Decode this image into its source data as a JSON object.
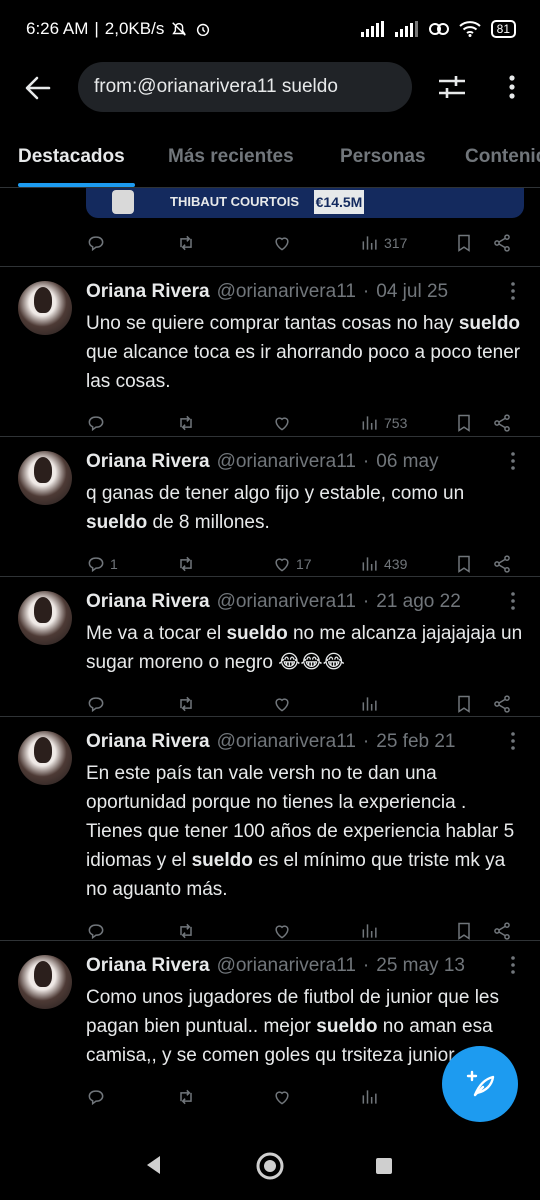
{
  "status": {
    "time": "6:26 AM",
    "speed": "2,0KB/s",
    "battery": "81"
  },
  "search": {
    "query": "from:@orianarivera11 sueldo"
  },
  "tabs": [
    {
      "label": "Destacados"
    },
    {
      "label": "Más recientes"
    },
    {
      "label": "Personas"
    },
    {
      "label": "Contenido"
    }
  ],
  "top_card": {
    "name": "THIBAUT COURTOIS",
    "price": "€14.5M",
    "views": "317"
  },
  "tweets": [
    {
      "name": "Oriana Rivera",
      "handle": "@orianarivera11",
      "date": "04 jul 25",
      "text_parts": [
        "Uno se quiere comprar tantas cosas no hay ",
        "sueldo",
        " que alcance toca es ir ahorrando poco a poco tener las cosas."
      ],
      "replies": "",
      "likes": "",
      "views": "753"
    },
    {
      "name": "Oriana Rivera",
      "handle": "@orianarivera11",
      "date": "06 may",
      "text_parts": [
        "q ganas de tener algo fijo y estable, como un ",
        "sueldo",
        " de 8 millones."
      ],
      "replies": "1",
      "likes": "17",
      "views": "439"
    },
    {
      "name": "Oriana Rivera",
      "handle": "@orianarivera11",
      "date": "21 ago 22",
      "text_parts": [
        "Me va a tocar el ",
        "sueldo",
        " no me alcanza jajajajaja un sugar moreno o negro 😂😂😂"
      ],
      "replies": "",
      "likes": "",
      "views": ""
    },
    {
      "name": "Oriana Rivera",
      "handle": "@orianarivera11",
      "date": "25 feb 21",
      "text_parts": [
        "En este país tan vale versh no te dan una oportunidad porque no tienes la experiencia . Tienes que tener 100 años de experiencia hablar 5 idiomas y el ",
        "sueldo",
        " es el mínimo que triste mk ya no aguanto más."
      ],
      "replies": "",
      "likes": "",
      "views": ""
    },
    {
      "name": "Oriana Rivera",
      "handle": "@orianarivera11",
      "date": "25 may 13",
      "text_parts": [
        "Como unos jugadores de fiutbol de junior que les pagan bien puntual.. mejor ",
        "sueldo",
        " no aman esa camisa,, y se comen goles qu trsiteza junior"
      ],
      "replies": "",
      "likes": "",
      "views": ""
    }
  ],
  "colors": {
    "accent": "#1d9bf0",
    "muted": "#71767b",
    "text": "#e7e9ea",
    "divider": "#2f3336",
    "background": "#000000"
  }
}
